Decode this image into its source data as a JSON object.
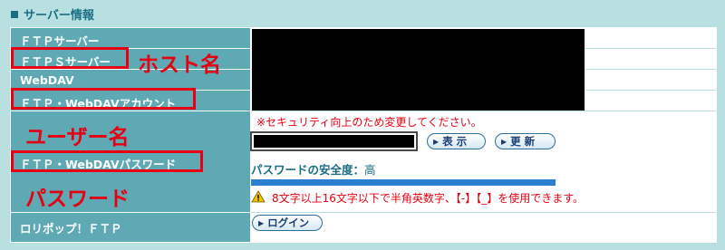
{
  "section": {
    "title": "サーバー情報"
  },
  "labels": {
    "ftp_server": "ＦＴＰサーバー",
    "ftps_server": "ＦＴＰＳサーバー",
    "webdav": "WebDAV",
    "account": "ＦＴＰ・WebDAVアカウント",
    "password": "ＦＴＰ・WebDAVパスワード",
    "lolipop_ftp": "ロリポップ！ＦＴＰ"
  },
  "annotations": {
    "host": "ホスト名",
    "user": "ユーザー名",
    "password": "パスワード"
  },
  "password_section": {
    "security_notice": "※セキュリティ向上のため変更してください。",
    "show_button": "表 示",
    "update_button": "更 新",
    "strength_label": "パスワードの安全度：",
    "strength_value": "高",
    "strength_level": 1.0,
    "rule_note": "8文字以上16文字以下で半角英数字、【-】【_】を使用できます。"
  },
  "login_button": "ログイン",
  "colors": {
    "background": "#b8e0e0",
    "label_bg": "#5ea9b3",
    "accent_red": "#e60012",
    "bar_blue": "#2a7fd0"
  }
}
